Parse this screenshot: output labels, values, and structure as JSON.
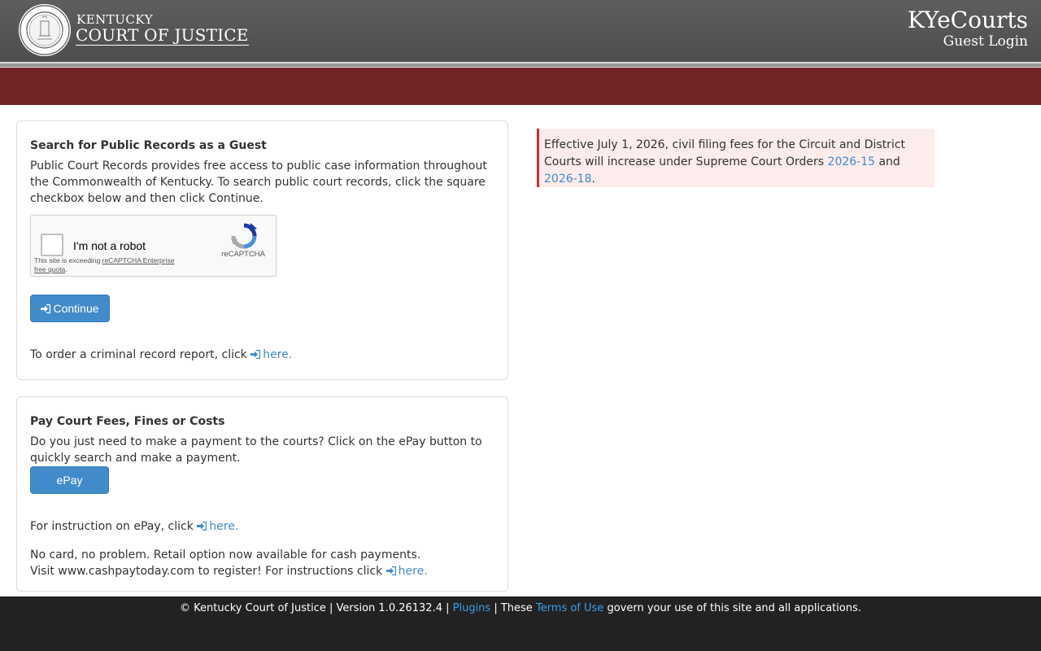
{
  "header": {
    "brand_top": "KENTUCKY",
    "brand_main": "COURT OF JUSTICE",
    "app_title": "KYeCourts",
    "app_subtitle": "Guest Login"
  },
  "search_panel": {
    "title": "Search for Public Records as a Guest",
    "description": "Public Court Records provides free access to public case information throughout the Commonwealth of Kentucky. To search public court records, click the square checkbox below and then click Continue.",
    "captcha": {
      "label": "I'm not a robot",
      "quota_prefix": "This site is exceeding ",
      "quota_link": "reCAPTCHA Enterprise free quota",
      "quota_suffix": ".",
      "brand": "reCAPTCHA"
    },
    "continue_label": "Continue",
    "criminal_text": "To order a criminal record report, click ",
    "criminal_link": "here."
  },
  "pay_panel": {
    "title": "Pay Court Fees, Fines or Costs",
    "description": "Do you just need to make a payment to the courts? Click on the ePay button to quickly search and make a payment.",
    "epay_label": "ePay",
    "instruction_text": "For instruction on ePay, click ",
    "instruction_link": "here.",
    "cash_text": "No card, no problem. Retail option now available for cash payments. Visit www.cashpaytoday.com to register! For instructions click ",
    "cash_link": "here."
  },
  "notice": {
    "text": "Effective July 1, 2026, civil filing fees for the Circuit and District Courts will increase under Supreme Court Orders ",
    "link1": "2026-15",
    "middle": " and ",
    "link2": "2026-18",
    "end": "."
  },
  "footer": {
    "copyright": "© Kentucky Court of Justice | Version 1.0.26132.4 | ",
    "plugins": "Plugins",
    "sep": " | These ",
    "terms": "Terms of Use",
    "end": " govern your use of this site and all applications."
  },
  "colors": {
    "header_bg": "#555555",
    "red_bar": "#722427",
    "button": "#428bca",
    "notice_bg": "#fcecec",
    "notice_border": "#c9302c",
    "footer_bg": "#222222"
  }
}
